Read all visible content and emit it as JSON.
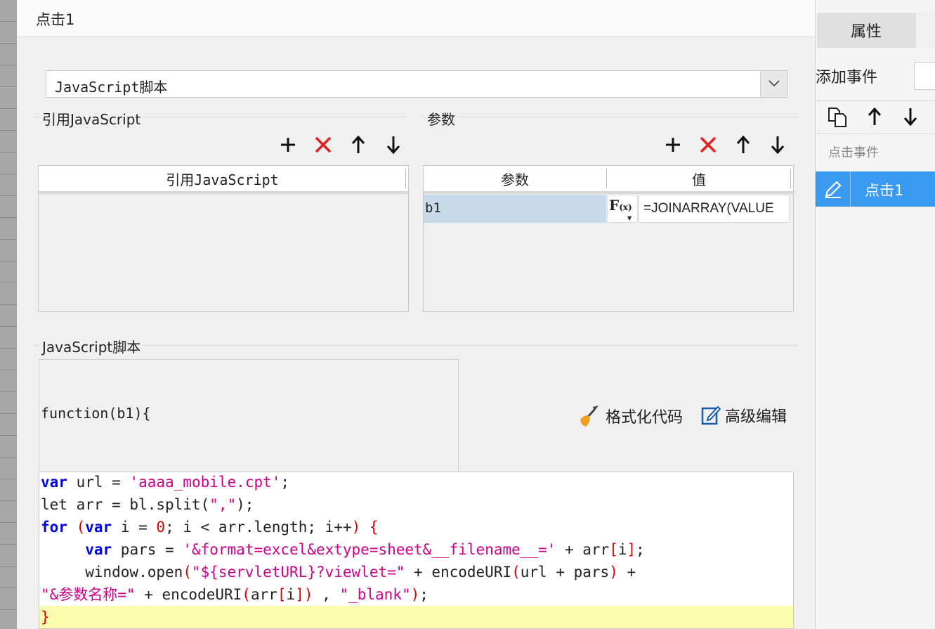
{
  "dialog": {
    "title": "点击1",
    "script_type": "JavaScript脚本",
    "ref_section_title": "引用JavaScript",
    "params_section_title": "参数",
    "ref_table": {
      "header": "引用JavaScript"
    },
    "params_table": {
      "headers": [
        "参数",
        "值"
      ],
      "rows": [
        {
          "name": "b1",
          "value": "=JOINARRAY(VALUE"
        }
      ],
      "fx_label": "F(x)"
    },
    "script_section_title": "JavaScript脚本",
    "function_signature": "function(b1){",
    "format_code_label": "格式化代码",
    "advanced_edit_label": "高级编辑",
    "code_lines": [
      "var url = 'aaaa_mobile.cpt';",
      "let arr = bl.split(\",\");",
      "for (var i = 0; i < arr.length; i++) {",
      "     var pars = '&format=excel&extype=sheet&__filename__=' + arr[i];",
      "     window.open(\"${servletURL}?viewlet=\" + encodeURI(url + pars) +",
      "\"&参数名称=\" + encodeURI(arr[i]) , \"_blank\");",
      "}"
    ]
  },
  "right_panel": {
    "tab_label": "属性",
    "add_event_label": "添加事件",
    "event_header": "点击事件",
    "events": [
      {
        "label": "点击1",
        "selected": true
      }
    ]
  },
  "colors": {
    "accent": "#3a9af0",
    "keyword": "#0000e0",
    "string": "#d0008a",
    "delete": "#e02020",
    "selected_cell": "#c9dbea",
    "current_line": "#fdfdb0"
  }
}
